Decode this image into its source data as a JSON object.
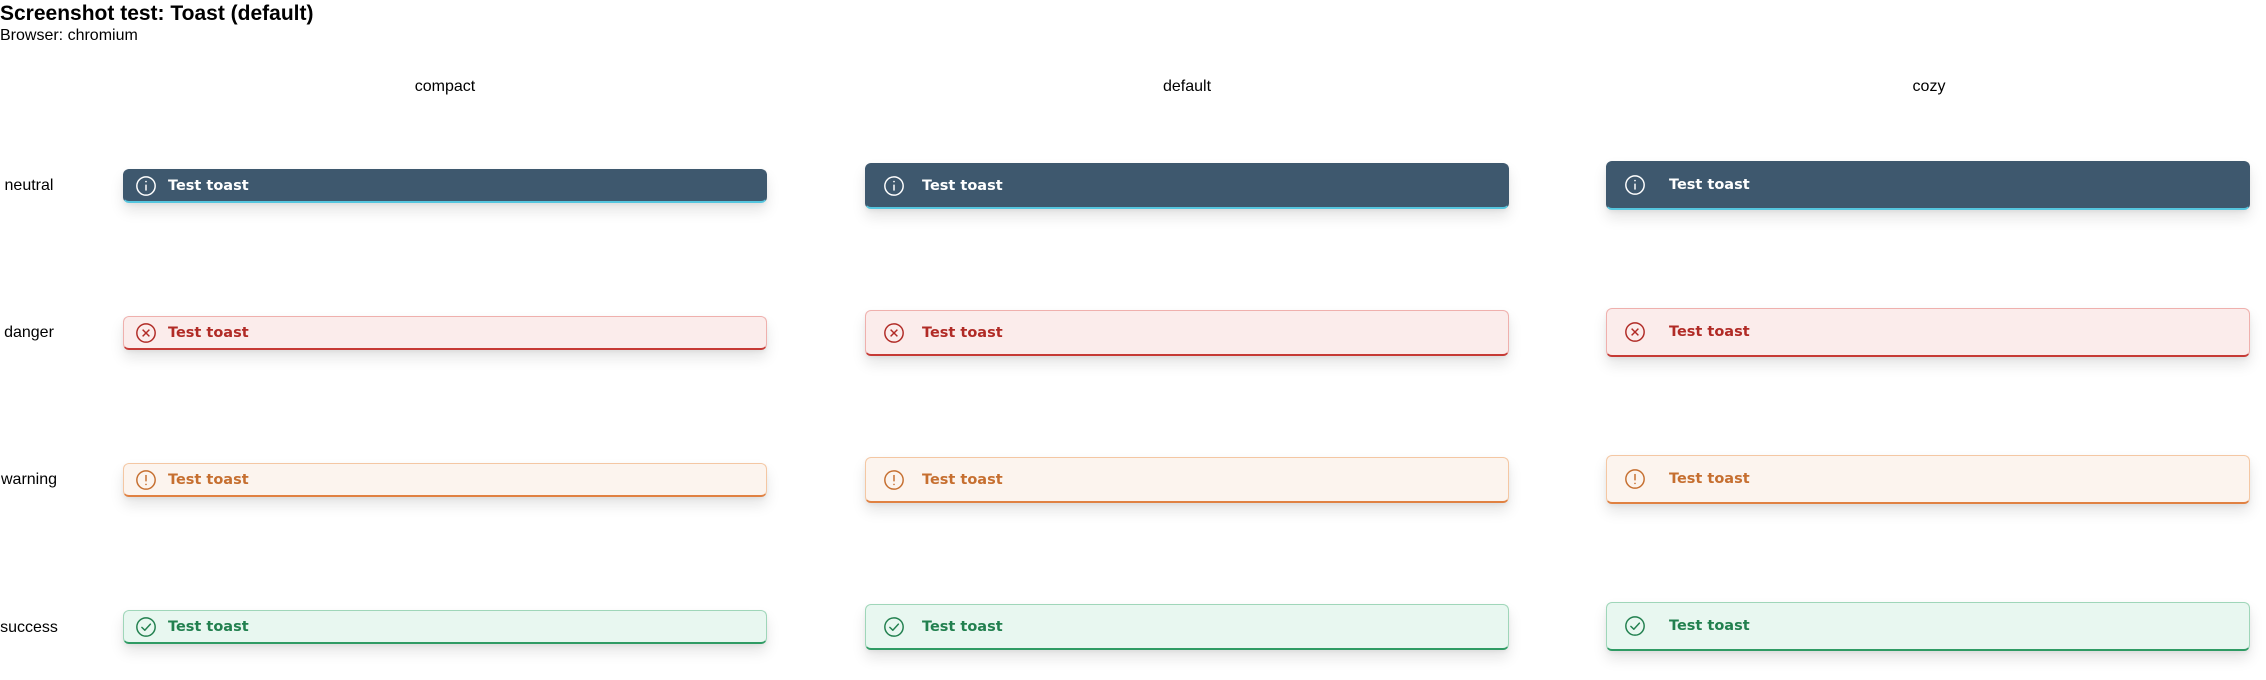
{
  "header": {
    "title": "Screenshot test: Toast (default)",
    "subtitle": "Browser: chromium"
  },
  "columns": [
    "compact",
    "default",
    "cozy"
  ],
  "rows": [
    "neutral",
    "danger",
    "warning",
    "success"
  ],
  "toast_message": "Test toast",
  "icons": {
    "neutral": "info-icon",
    "danger": "error-circle-icon",
    "warning": "warning-icon",
    "success": "check-circle-icon"
  },
  "colors": {
    "neutral": "#3e586e",
    "neutral_accent": "#55c6df",
    "danger": "#b12b26",
    "warning": "#c66f30",
    "success": "#22804f"
  }
}
